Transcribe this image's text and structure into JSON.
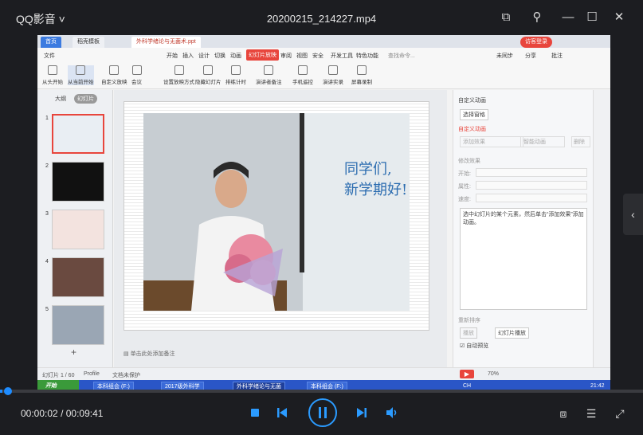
{
  "titlebar": {
    "app_name": "QQ影音",
    "file_name": "20200215_214227.mp4"
  },
  "wps": {
    "tabs": [
      "首页",
      "稻壳模板",
      "外科学绪论与无菌术.ppt"
    ],
    "login_label": "访客登录",
    "menu": [
      "文件",
      "开始",
      "插入",
      "设计",
      "切换",
      "动画",
      "幻灯片放映",
      "审阅",
      "视图",
      "安全",
      "开发工具",
      "特色功能",
      "查找命令..."
    ],
    "menu_right": [
      "未同步",
      "分享",
      "批注"
    ],
    "ribbon": [
      "从头开始",
      "从当前开始",
      "自定义放映",
      "会议",
      "设置放映方式",
      "隐藏幻灯片",
      "排练计时",
      "演讲者备注",
      "手机遥控",
      "演讲实录",
      "屏幕录制"
    ],
    "panel_tabs": [
      "大纲",
      "幻灯片"
    ],
    "slide_numbers": [
      "1",
      "2",
      "3",
      "4",
      "5"
    ],
    "slide_text_line1": "同学们,",
    "slide_text_line2": "新学期好!",
    "notes_placeholder": "单击此处添加备注",
    "right_panel": {
      "header": "自定义动画",
      "select_pane": "选择窗格",
      "section_title": "自定义动画",
      "add_effect": "添加效果",
      "smart_anim": "智能动画",
      "delete": "删除",
      "modify_title": "修改效果",
      "start_label": "开始:",
      "property_label": "属性:",
      "speed_label": "速度:",
      "hint": "选中幻灯片的某个元素，然后单击“添加效果”添加动画。",
      "reorder": "重新排序",
      "play": "播放",
      "slideshow": "幻灯片播放",
      "autopreview": "自动预览"
    },
    "status": {
      "slide_count": "幻灯片 1 / 60",
      "profile": "Profile",
      "doc_protect": "文档未保护",
      "zoom": "70%"
    },
    "taskbar": {
      "start": "开始",
      "items": [
        "本科组会 (F:)",
        "2017级外科学",
        "外科学绪论与无菌",
        "本科组会 (F:)"
      ],
      "clock": "21:42",
      "ime": "CH"
    }
  },
  "controls": {
    "time_current": "00:00:02",
    "time_total": "00:09:41",
    "progress_fraction": 0.0034
  }
}
